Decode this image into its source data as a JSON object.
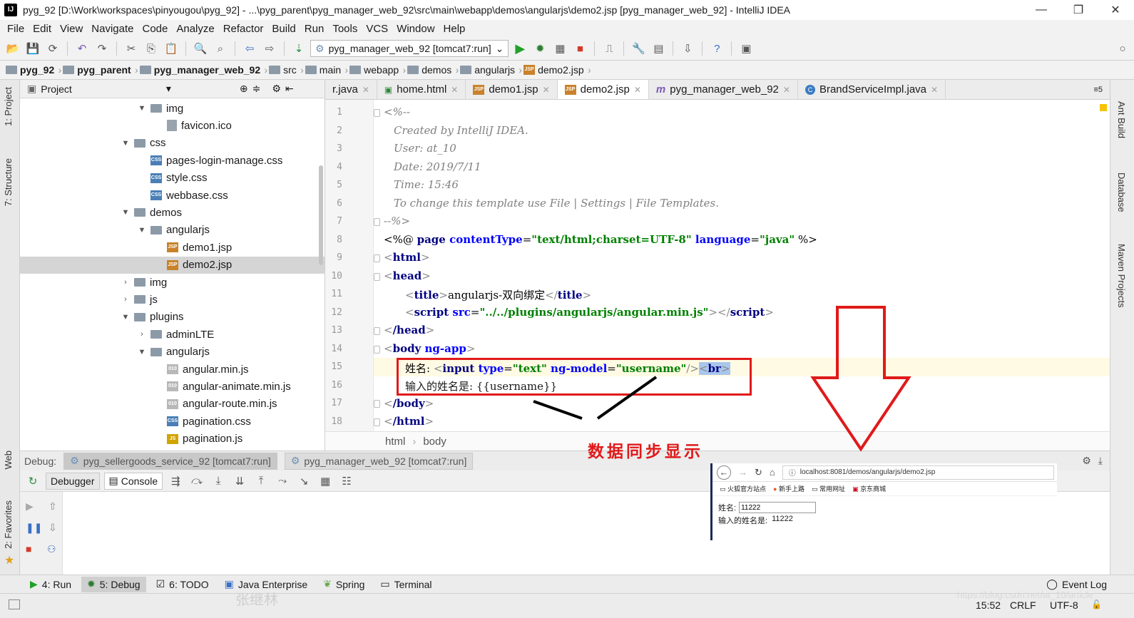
{
  "window": {
    "title": "pyg_92 [D:\\Work\\workspaces\\pinyougou\\pyg_92] - ...\\pyg_parent\\pyg_manager_web_92\\src\\main\\webapp\\demos\\angularjs\\demo2.jsp [pyg_manager_web_92] - IntelliJ IDEA",
    "app_icon": "IJ"
  },
  "menu": [
    "File",
    "Edit",
    "View",
    "Navigate",
    "Code",
    "Analyze",
    "Refactor",
    "Build",
    "Run",
    "Tools",
    "VCS",
    "Window",
    "Help"
  ],
  "toolbar": {
    "run_config": "pyg_manager_web_92 [tomcat7:run]"
  },
  "breadcrumb": [
    "pyg_92",
    "pyg_parent",
    "pyg_manager_web_92",
    "src",
    "main",
    "webapp",
    "demos",
    "angularjs",
    "demo2.jsp"
  ],
  "left_strip": {
    "project": "1: Project",
    "structure": "7: Structure",
    "web": "Web",
    "favorites": "2: Favorites"
  },
  "project_panel": {
    "header": "Project",
    "tree": [
      {
        "label": "img",
        "type": "folder",
        "arrow": "v"
      },
      {
        "label": "favicon.ico",
        "type": "ico"
      },
      {
        "label": "css",
        "type": "folder",
        "arrow": "v"
      },
      {
        "label": "pages-login-manage.css",
        "type": "css"
      },
      {
        "label": "style.css",
        "type": "css"
      },
      {
        "label": "webbase.css",
        "type": "css"
      },
      {
        "label": "demos",
        "type": "folder",
        "arrow": "v"
      },
      {
        "label": "angularjs",
        "type": "folder",
        "arrow": "v"
      },
      {
        "label": "demo1.jsp",
        "type": "jsp"
      },
      {
        "label": "demo2.jsp",
        "type": "jsp",
        "selected": true
      },
      {
        "label": "img",
        "type": "folder",
        "arrow": ">"
      },
      {
        "label": "js",
        "type": "folder",
        "arrow": ">"
      },
      {
        "label": "plugins",
        "type": "folder",
        "arrow": "v"
      },
      {
        "label": "adminLTE",
        "type": "folder",
        "arrow": ">"
      },
      {
        "label": "angularjs",
        "type": "folder",
        "arrow": "v"
      },
      {
        "label": "angular.min.js",
        "type": "minjs"
      },
      {
        "label": "angular-animate.min.js",
        "type": "minjs"
      },
      {
        "label": "angular-route.min.js",
        "type": "minjs"
      },
      {
        "label": "pagination.css",
        "type": "css"
      },
      {
        "label": "pagination.js",
        "type": "js"
      }
    ]
  },
  "editor_tabs": [
    {
      "label": "r.java"
    },
    {
      "label": "home.html"
    },
    {
      "label": "demo1.jsp"
    },
    {
      "label": "demo2.jsp",
      "active": true
    },
    {
      "label": "pyg_manager_web_92"
    },
    {
      "label": "BrandServiceImpl.java"
    }
  ],
  "editor_tabs_overflow": "≡5",
  "code_lines": [
    "1",
    "2",
    "3",
    "4",
    "5",
    "6",
    "7",
    "8",
    "9",
    "10",
    "11",
    "12",
    "13",
    "14",
    "15",
    "16",
    "17",
    "18"
  ],
  "code": {
    "l1": "<%--",
    "l2": "Created by IntelliJ IDEA.",
    "l3": "User: at_10",
    "l4": "Date: 2019/7/11",
    "l5": "Time: 15:46",
    "l6": "To change this template use File | Settings | File Templates.",
    "l7": "--%>",
    "l8_a": "<%@ ",
    "l8_b": "page ",
    "l8_c": "contentType",
    "l8_d": "=",
    "l8_e": "\"text/html;charset=UTF-8\"",
    "l8_f": " language",
    "l8_g": "=",
    "l8_h": "\"java\"",
    "l8_i": " %>",
    "l9": "html",
    "l10": "head",
    "l11_tag": "title",
    "l11_text": "angularjs-双向绑定",
    "l12_tag": "script",
    "l12_attr": " src",
    "l12_val": "\"../../plugins/angularjs/angular.min.js\"",
    "l13": "/head",
    "l14_tag": "body",
    "l14_attr": " ng-app",
    "l15_text": "姓名:",
    "l15_tag": "input",
    "l15_attr1": " type",
    "l15_val1": "\"text\"",
    "l15_attr2": " ng-model",
    "l15_val2": "\"username\"",
    "l15_br": "br",
    "l16": "输入的姓名是: {{username}}",
    "l17": "/body",
    "l18": "/html"
  },
  "editor_breadcrumb": [
    "html",
    "body"
  ],
  "right_strip": [
    "Ant Build",
    "Database",
    "Maven Projects"
  ],
  "debug": {
    "label": "Debug:",
    "tabs": [
      "pyg_sellergoods_service_92 [tomcat7:run]",
      "pyg_manager_web_92 [tomcat7:run]"
    ],
    "subtabs": [
      "Debugger",
      "Console"
    ]
  },
  "annotation": {
    "text": "数据同步显示"
  },
  "browser": {
    "url": "localhost:8081/demos/angularjs/demo2.jsp",
    "url_host": "localhost",
    "bookmarks": [
      "火狐官方站点",
      "新手上路",
      "常用网址",
      "京东商城"
    ],
    "name_label": "姓名:",
    "input_value": "11222",
    "output_label": "输入的姓名是:",
    "output_value": "11222"
  },
  "bottom_tabs": [
    {
      "label": "4: Run"
    },
    {
      "label": "5: Debug",
      "selected": true
    },
    {
      "label": "6: TODO"
    },
    {
      "label": "Java Enterprise"
    },
    {
      "label": "Spring"
    },
    {
      "label": "Terminal"
    }
  ],
  "event_log": "Event Log",
  "status": {
    "time": "15:52",
    "line_sep": "CRLF",
    "encoding": "UTF-8",
    "watermark_left": "张继林",
    "watermark_right": "https://blog.csdn.net/at_10/article"
  },
  "colors": {
    "accent_red": "#e01a1a",
    "tag": "#000080",
    "attr": "#0000ff",
    "string": "#008000",
    "comment": "#808080"
  },
  "icons": [
    "folder-icon",
    "jsp-icon",
    "css-icon",
    "js-icon",
    "run-icon",
    "debug-icon",
    "stop-icon",
    "search-icon",
    "help-icon",
    "gear-icon"
  ]
}
